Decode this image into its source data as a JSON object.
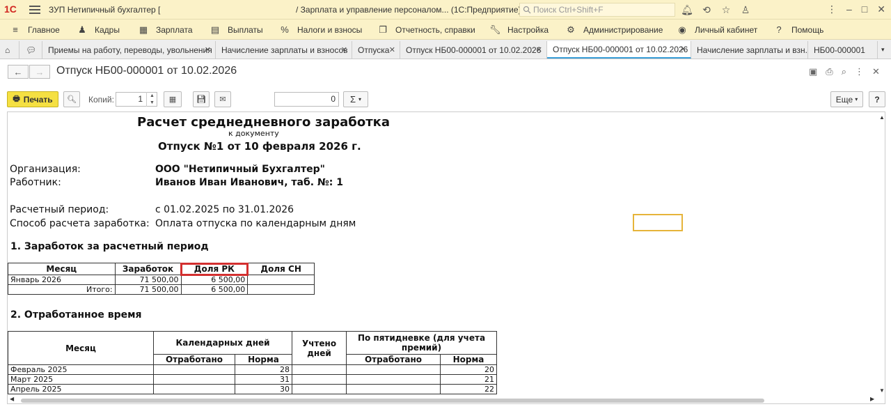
{
  "app": {
    "logo": "1С",
    "title_left": "ЗУП Нетипичный бухгалтер [",
    "title_right": "/ Зарплата и управление персоналом... (1С:Предприятие)",
    "search_placeholder": "Поиск Ctrl+Shift+F"
  },
  "menu": [
    {
      "icon": "hamburger-icon",
      "label": "Главное"
    },
    {
      "icon": "people-icon",
      "label": "Кадры"
    },
    {
      "icon": "calculator-icon",
      "label": "Зарплата"
    },
    {
      "icon": "cash-icon",
      "label": "Выплаты"
    },
    {
      "icon": "percent-icon",
      "label": "Налоги и взносы"
    },
    {
      "icon": "reports-icon",
      "label": "Отчетность, справки"
    },
    {
      "icon": "wrench-icon",
      "label": "Настройка"
    },
    {
      "icon": "gear-icon",
      "label": "Администрирование"
    },
    {
      "icon": "user-circle-icon",
      "label": "Личный кабинет"
    },
    {
      "icon": "question-icon",
      "label": "Помощь"
    }
  ],
  "tabs": [
    {
      "label": "Приемы на работу, переводы, увольнения",
      "closable": true
    },
    {
      "label": "Начисление зарплаты и взносов",
      "closable": true
    },
    {
      "label": "Отпуска",
      "closable": true
    },
    {
      "label": "Отпуск НБ00-000001 от 10.02.2026",
      "closable": true
    },
    {
      "label": "Отпуск НБ00-000001 от 10.02.2026",
      "closable": true,
      "active": true
    },
    {
      "label": "Начисление зарплаты и взн...",
      "closable": false
    },
    {
      "label": "НБ00-000001",
      "closable": false
    }
  ],
  "form": {
    "title": "Отпуск НБ00-000001 от 10.02.2026"
  },
  "toolbar": {
    "print_label": "Печать",
    "copies_label": "Копий:",
    "copies_value": "1",
    "sum_value": "0",
    "sum_label": "Σ",
    "more_label": "Еще",
    "help_label": "?"
  },
  "report": {
    "title": "Расчет среднедневного заработка",
    "subtitle": "к документу",
    "doc_name": "Отпуск №1 от 10 февраля 2026 г.",
    "org_label": "Организация:",
    "org_value": "ООО \"Нетипичный Бухгалтер\"",
    "emp_label": "Работник:",
    "emp_value": "Иванов Иван Иванович, таб. №: 1",
    "period_label": "Расчетный период:",
    "period_value": "с 01.02.2025 по 31.01.2026",
    "method_label": "Способ расчета заработка:",
    "method_value": "Оплата отпуска по календарным дням",
    "section1": "1. Заработок за расчетный период",
    "t1": {
      "headers": [
        "Месяц",
        "Заработок",
        "Доля РК",
        "Доля СН"
      ],
      "rows": [
        [
          "Январь 2026",
          "71 500,00",
          "6 500,00",
          ""
        ]
      ],
      "total": [
        "Итого:",
        "71 500,00",
        "6 500,00",
        ""
      ]
    },
    "section2": "2. Отработанное время",
    "t2": {
      "h_month": "Месяц",
      "h_cal": "Календарных дней",
      "h_counted": "Учтено дней",
      "h_five": "По пятидневке (для учета премий)",
      "h_worked": "Отработано",
      "h_norm": "Норма",
      "h_worked2": "Отработано",
      "h_norm2": "Норма",
      "rows": [
        [
          "Февраль 2025",
          "",
          "28",
          "",
          "",
          "20"
        ],
        [
          "Март 2025",
          "",
          "31",
          "",
          "",
          "21"
        ],
        [
          "Апрель 2025",
          "",
          "30",
          "",
          "",
          "22"
        ]
      ]
    }
  }
}
